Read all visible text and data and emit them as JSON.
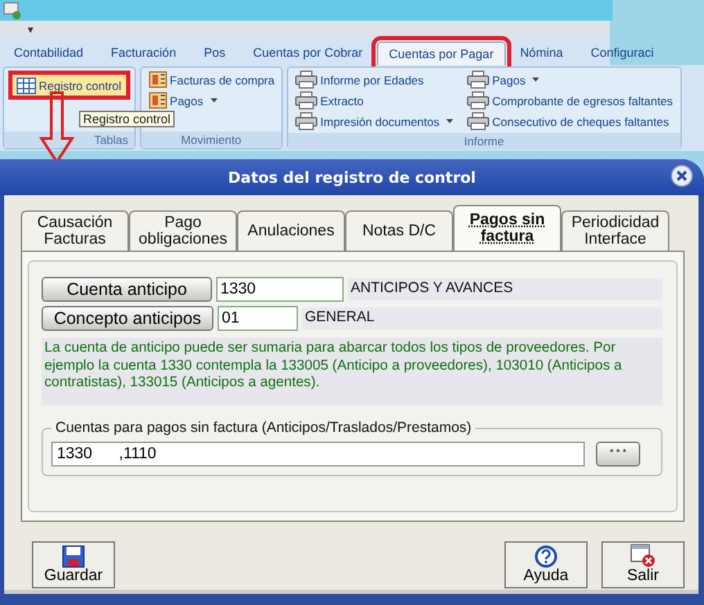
{
  "quick_access": {
    "menu": "▾"
  },
  "ribbon_tabs": [
    {
      "label": "Contabilidad",
      "selected": false,
      "marked": false
    },
    {
      "label": "Facturación",
      "selected": false,
      "marked": false
    },
    {
      "label": "Pos",
      "selected": false,
      "marked": false
    },
    {
      "label": "Cuentas por Cobrar",
      "selected": false,
      "marked": false
    },
    {
      "label": "Cuentas por Pagar",
      "selected": true,
      "marked": true
    },
    {
      "label": "Nómina",
      "selected": false,
      "marked": false
    },
    {
      "label": "Configuraci",
      "selected": false,
      "marked": false
    }
  ],
  "ribbon_groups": [
    {
      "title": "Tablas",
      "columns": [
        [
          {
            "label": "Registro control",
            "kind": "table",
            "highlighted": true,
            "marked": true,
            "dropdown": false
          }
        ]
      ]
    },
    {
      "title": "Movimiento",
      "columns": [
        [
          {
            "label": "Facturas de compra",
            "kind": "book",
            "highlighted": false,
            "marked": false,
            "dropdown": false
          },
          {
            "label": "Pagos",
            "kind": "book",
            "highlighted": false,
            "marked": false,
            "dropdown": true
          }
        ]
      ]
    },
    {
      "title": "Informe",
      "columns": [
        [
          {
            "label": "Informe por Edades",
            "kind": "printer",
            "highlighted": false,
            "marked": false,
            "dropdown": false
          },
          {
            "label": "Extracto",
            "kind": "printer",
            "highlighted": false,
            "marked": false,
            "dropdown": false
          },
          {
            "label": "Impresión documentos",
            "kind": "printer",
            "highlighted": false,
            "marked": false,
            "dropdown": true
          }
        ],
        [
          {
            "label": "Pagos",
            "kind": "printer",
            "highlighted": false,
            "marked": false,
            "dropdown": true
          },
          {
            "label": "Comprobante de egresos faltantes",
            "kind": "printer",
            "highlighted": false,
            "marked": false,
            "dropdown": false
          },
          {
            "label": "Consecutivo de cheques faltantes",
            "kind": "printer",
            "highlighted": false,
            "marked": false,
            "dropdown": false
          }
        ]
      ]
    }
  ],
  "tooltip": "Registro control",
  "dialog": {
    "title": "Datos del registro de control",
    "tabs": [
      {
        "label": "Causación\nFacturas",
        "selected": false
      },
      {
        "label": "Pago\nobligaciones",
        "selected": false
      },
      {
        "label": "Anulaciones",
        "selected": false
      },
      {
        "label": "Notas D/C",
        "selected": false
      },
      {
        "label": "Pagos sin\nfactura",
        "selected": true
      },
      {
        "label": "Periodicidad\nInterface",
        "selected": false
      }
    ],
    "lookups": [
      {
        "button": "Cuenta anticipo",
        "value": "1330",
        "description": "ANTICIPOS Y AVANCES"
      },
      {
        "button": "Concepto anticipos",
        "value": "01",
        "description": "GENERAL"
      }
    ],
    "note": "La cuenta de anticipo puede ser sumaria para abarcar todos los tipos de proveedores. Por ejemplo la cuenta 1330 contempla la 133005 (Anticipo a proveedores), 103010 (Anticipos a contratistas), 133015 (Anticipos a agentes).",
    "accounts": {
      "legend": "Cuentas para pagos sin factura (Anticipos/Traslados/Prestamos)",
      "value": "1330      ,1110",
      "button": "* * *"
    },
    "buttons": [
      {
        "label": "Guardar",
        "kind": "save"
      },
      {
        "label": "Ayuda",
        "kind": "help"
      },
      {
        "label": "Salir",
        "kind": "exit"
      }
    ]
  }
}
